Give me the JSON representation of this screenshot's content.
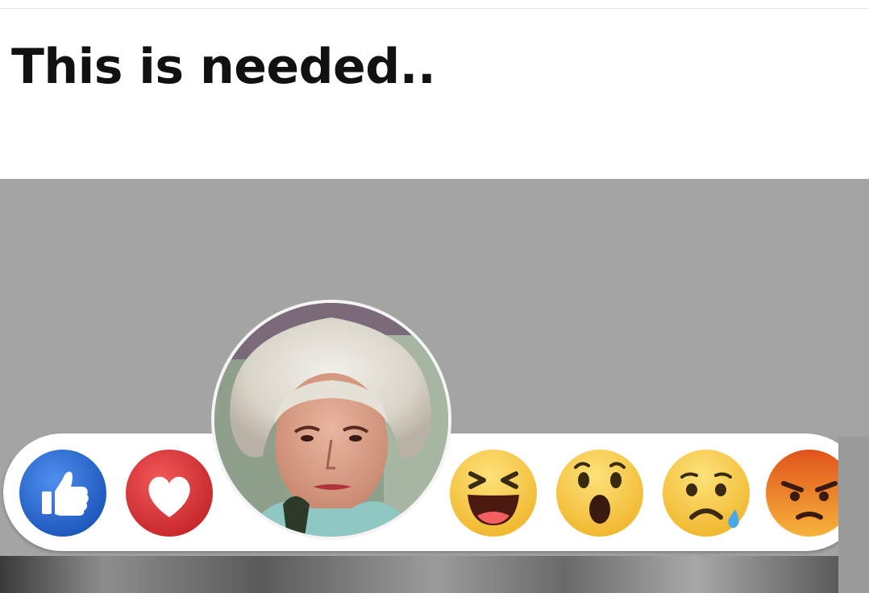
{
  "caption": {
    "text": "This is needed.."
  },
  "reactions": [
    {
      "name": "like",
      "icon": "thumbs-up-icon",
      "color": "#2d6fd6"
    },
    {
      "name": "love",
      "icon": "heart-icon",
      "color": "#e03c3f"
    },
    {
      "name": "custom-photo",
      "icon": "photo-face"
    },
    {
      "name": "haha",
      "icon": "laughing-face-icon",
      "color": "#f5c23a"
    },
    {
      "name": "wow",
      "icon": "surprised-face-icon",
      "color": "#f5c23a"
    },
    {
      "name": "sad",
      "icon": "crying-face-icon",
      "color": "#f5c23a"
    },
    {
      "name": "angry",
      "icon": "angry-face-icon",
      "color": "#e0651c"
    }
  ],
  "colors": {
    "background": "#ffffff",
    "panel": "#a4a4a4",
    "bar": "#ffffff"
  }
}
